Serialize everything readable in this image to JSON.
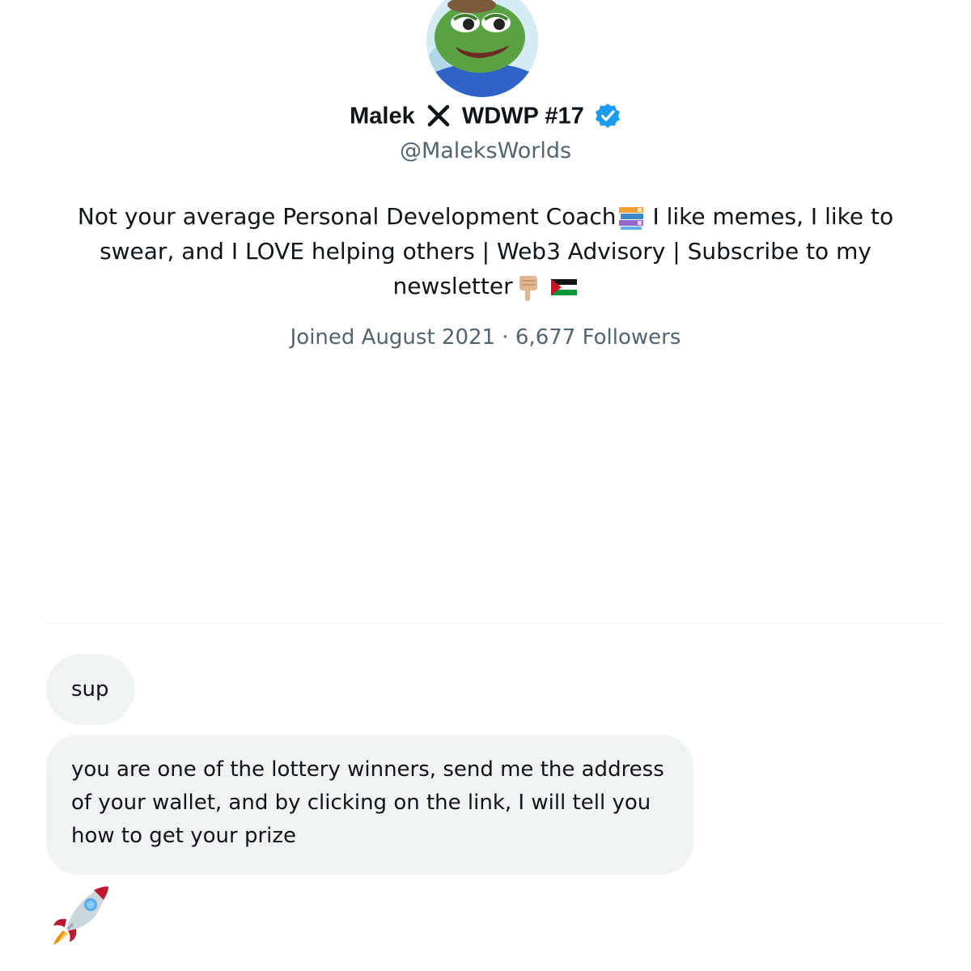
{
  "profile": {
    "name_before": "Malek",
    "name_after": "WDWP #17",
    "handle": "@MaleksWorlds",
    "bio_part1": "Not your average Personal Development Coach",
    "bio_part2": " I like memes, I like to swear, and I LOVE helping others | Web3 Advisory | Subscribe to my newsletter",
    "joined": "Joined August 2021",
    "separator": "·",
    "followers": "6,677 Followers"
  },
  "messages": [
    {
      "text": "sup"
    },
    {
      "text": "you are one of the lottery winners, send me the address of your wallet, and by clicking on the link, I will tell you how to get your prize"
    }
  ],
  "icons": {
    "avatar": "frog-avatar",
    "name_mark": "x-icon",
    "verified": "verified-badge-icon",
    "books": "books-emoji-icon",
    "pointing": "pointing-down-emoji-icon",
    "flag": "palestine-flag-icon",
    "reaction": "rocket-emoji-icon"
  },
  "colors": {
    "verified": "#1d9bf0",
    "secondary_text": "#536471",
    "bubble_bg": "#eff3f4"
  }
}
